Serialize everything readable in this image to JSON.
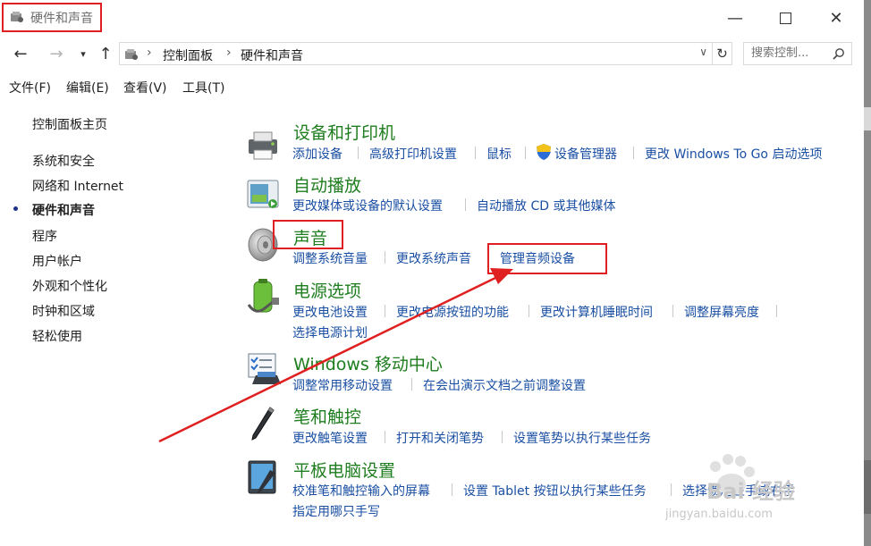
{
  "window": {
    "title": "硬件和声音"
  },
  "address": {
    "crumbs": [
      "控制面板",
      "硬件和声音"
    ],
    "search_placeholder": "搜索控制..."
  },
  "menu": [
    "文件(F)",
    "编辑(E)",
    "查看(V)",
    "工具(T)"
  ],
  "sidebar": {
    "items": [
      {
        "label": "控制面板主页"
      },
      {
        "label": "系统和安全"
      },
      {
        "label": "网络和 Internet"
      },
      {
        "label": "硬件和声音",
        "active": true
      },
      {
        "label": "程序"
      },
      {
        "label": "用户帐户"
      },
      {
        "label": "外观和个性化"
      },
      {
        "label": "时钟和区域"
      },
      {
        "label": "轻松使用"
      }
    ]
  },
  "categories": [
    {
      "title": "设备和打印机",
      "icon": "printer-icon",
      "links": [
        "添加设备",
        "高级打印机设置",
        "鼠标",
        "设备管理器",
        "更改 Windows To Go 启动选项"
      ]
    },
    {
      "title": "自动播放",
      "icon": "autoplay-icon",
      "links": [
        "更改媒体或设备的默认设置",
        "自动播放 CD 或其他媒体"
      ]
    },
    {
      "title": "声音",
      "icon": "speaker-icon",
      "links": [
        "调整系统音量",
        "更改系统声音",
        "管理音频设备"
      ]
    },
    {
      "title": "电源选项",
      "icon": "battery-icon",
      "links": [
        "更改电池设置",
        "更改电源按钮的功能",
        "更改计算机睡眠时间",
        "调整屏幕亮度",
        "选择电源计划"
      ]
    },
    {
      "title": "Windows 移动中心",
      "icon": "mobility-center-icon",
      "links": [
        "调整常用移动设置",
        "在会出演示文档之前调整设置"
      ]
    },
    {
      "title": "笔和触控",
      "icon": "pen-icon",
      "links": [
        "更改触笔设置",
        "打开和关闭笔势",
        "设置笔势以执行某些任务"
      ]
    },
    {
      "title": "平板电脑设置",
      "icon": "tablet-icon",
      "links": [
        "校准笔和触控输入的屏幕",
        "设置 Tablet 按钮以执行某些任务",
        "选择惯用左手或右手",
        "指定用哪只手写"
      ]
    }
  ],
  "watermark": {
    "big": "Bai 经验",
    "url": "jingyan.baidu.com"
  },
  "colors": {
    "link": "#1a4fa3",
    "category": "#1e7d1e",
    "annotation": "#e02020"
  }
}
